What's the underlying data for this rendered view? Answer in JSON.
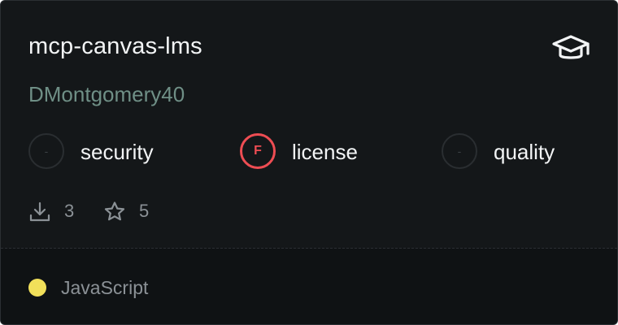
{
  "card": {
    "title": "mcp-canvas-lms",
    "author": "DMontgomery40",
    "category_icon": "graduation-cap-icon"
  },
  "scores": [
    {
      "grade": "-",
      "label": "security",
      "status": "none"
    },
    {
      "grade": "F",
      "label": "license",
      "status": "fail"
    },
    {
      "grade": "-",
      "label": "quality",
      "status": "none"
    }
  ],
  "stats": {
    "downloads": "3",
    "stars": "5",
    "download_icon": "download-icon",
    "star_icon": "star-icon"
  },
  "footer": {
    "language": "JavaScript",
    "language_color": "#f1e05a"
  },
  "colors": {
    "card_bg": "#141719",
    "footer_bg": "#0f1214",
    "fail": "#ee4d53",
    "author": "#6f8f86"
  }
}
